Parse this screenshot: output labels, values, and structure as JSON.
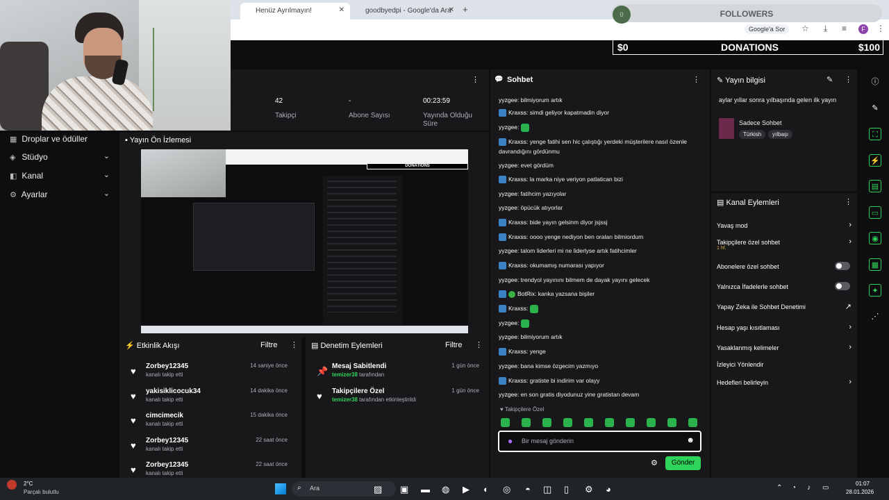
{
  "browser": {
    "tabs": [
      {
        "label": "Henüz Ayrılmayın!",
        "active": true
      },
      {
        "label": "goodbyedpi - Google'da Ara",
        "active": false
      }
    ],
    "search_chip": "Google'a Sor",
    "profile_initial": "F"
  },
  "overlay": {
    "followers": "FOLLOWERS",
    "donations_label": "DONATIONS",
    "donations_min": "$0",
    "donations_max": "$100",
    "followers_progress": 0.0
  },
  "sidebar": {
    "items": [
      {
        "label": "Droplar ve ödüller",
        "icon": "gift-icon"
      },
      {
        "label": "Stüdyo",
        "icon": "studio-icon"
      },
      {
        "label": "Kanal",
        "icon": "channel-icon"
      },
      {
        "label": "Ayarlar",
        "icon": "gear-icon"
      }
    ]
  },
  "stats": [
    {
      "value": "42",
      "label": "Takipçi"
    },
    {
      "value": "-",
      "label": "Abone Sayısı"
    },
    {
      "value": "00:23:59",
      "label": "Yayında Olduğu Süre"
    }
  ],
  "preview": {
    "title": "Yayın Ön İzlemesi"
  },
  "activity": {
    "title": "Etkinlik Akışı",
    "filter": "Filtre",
    "events": [
      {
        "name": "Zorbey12345",
        "sub": "kanalı takip etti",
        "time": "14 saniye önce"
      },
      {
        "name": "yakisiklicocuk34",
        "sub": "kanalı takip etti",
        "time": "14 dakika önce"
      },
      {
        "name": "cimcimecik",
        "sub": "kanalı takip etti",
        "time": "15 dakika önce"
      },
      {
        "name": "Zorbey12345",
        "sub": "kanalı takip etti",
        "time": "22 saat önce"
      },
      {
        "name": "Zorbey12345",
        "sub": "kanalı takip etti",
        "time": "22 saat önce"
      }
    ]
  },
  "moderation": {
    "title": "Denetim Eylemleri",
    "filter": "Filtre",
    "events": [
      {
        "name": "Mesaj Sabitlendi",
        "user": "temizer38",
        "sub": "tarafından",
        "time": "1 gün önce"
      },
      {
        "name": "Takipçilere Özel",
        "user": "temizer38",
        "sub": "tarafından etkinleştirildi",
        "time": "1 gün önce"
      }
    ]
  },
  "chat": {
    "title": "Sohbet",
    "messages": [
      {
        "user": "yyzgee",
        "text": "bilmiyorum artık"
      },
      {
        "user": "Kraxss",
        "text": "simdi geliyor kapatmadin diyor"
      },
      {
        "user": "yyzgee",
        "text": ""
      },
      {
        "user": "Kraxss",
        "text": "yenge fatihi sen hic çalıştığı yerdeki müşterilere nasıl özenle davrandığını gördünmu"
      },
      {
        "user": "yyzgee",
        "text": "evet gördüm"
      },
      {
        "user": "Kraxss",
        "text": "la marka niye veriyon patlatican bizi"
      },
      {
        "user": "yyzgee",
        "text": "fatihcim yazıyolar"
      },
      {
        "user": "yyzgee",
        "text": "öpücük atıyorlar"
      },
      {
        "user": "Kraxss",
        "text": "bide yayın gelsinm diyor jsjssj"
      },
      {
        "user": "Kraxss",
        "text": "oooo yenge nediyon ben oraları bilmiordum"
      },
      {
        "user": "yyzgee",
        "text": "talom liderleri mi ne liderlyse artık fatihcimler"
      },
      {
        "user": "Kraxss",
        "text": "okumamış numarası yapıyor"
      },
      {
        "user": "yyzgee",
        "text": "trendyol yayınını bilmem de dayak yayını gelecek"
      },
      {
        "user": "BotRix",
        "text": "kanka yazsana bişiler"
      },
      {
        "user": "Kraxss",
        "text": ""
      },
      {
        "user": "yyzgee",
        "text": ""
      },
      {
        "user": "yyzgee",
        "text": "bilmiyorum artık"
      },
      {
        "user": "Kraxss",
        "text": "yenge"
      },
      {
        "user": "yyzgee",
        "text": "bana kimse özgecim yazmıyo"
      },
      {
        "user": "Kraxss",
        "text": "gratiste bi indirim var olayy"
      },
      {
        "user": "yyzgee",
        "text": "en son gratis diyodunuz yine gratistan devam"
      }
    ],
    "followers_only": "Takipçilere Özel",
    "input_placeholder": "Bir mesaj gönderin",
    "send_label": "Gönder"
  },
  "stream_info": {
    "title": "Yayın bilgisi",
    "stream_title": "aylar yıllar sonra yılbaşında gelen ilk yayın",
    "category": "Sadece Sohbet",
    "tags": [
      "Türkish",
      "yılbaşı"
    ]
  },
  "channel_actions": {
    "title": "Kanal Eylemleri",
    "items": [
      {
        "label": "Yavaş mod",
        "control": "chevron"
      },
      {
        "label": "Takipçilere özel sohbet",
        "sub": "1 hf.",
        "control": "chevron"
      },
      {
        "label": "Abonelere özel sohbet",
        "control": "toggle"
      },
      {
        "label": "Yalnızca İfadelerle sohbet",
        "control": "toggle"
      },
      {
        "label": "Yapay Zeka ile Sohbet Denetimi",
        "control": "external"
      },
      {
        "label": "Hesap yaşı kısıtlaması",
        "control": "chevron"
      },
      {
        "label": "Yasaklanmış kelimeler",
        "control": "chevron"
      },
      {
        "label": "İzleyici Yönlendir",
        "control": "none"
      },
      {
        "label": "Hedefleri belirleyin",
        "control": "chevron"
      }
    ]
  },
  "taskbar": {
    "weather_temp": "2°C",
    "weather_desc": "Parçalı bulutlu",
    "search": "Ara",
    "time": "01:07",
    "date": "28.01.2026"
  },
  "colors": {
    "accent": "#2fd45a",
    "panel": "#18181b",
    "bg": "#0e0e10",
    "badge": "#3b82c4"
  }
}
